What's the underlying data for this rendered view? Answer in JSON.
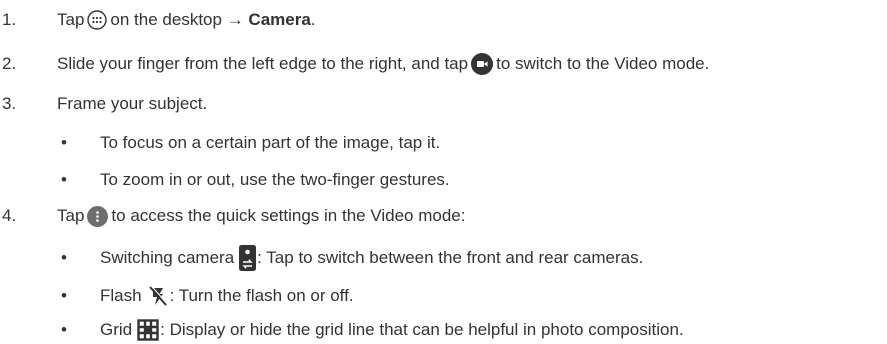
{
  "steps": [
    {
      "num": "1.",
      "pre": "Tap",
      "mid": "on the desktop",
      "arrow": "→",
      "bold": "Camera",
      "end": "."
    },
    {
      "num": "2.",
      "pre": "Slide your finger from the left edge to the right, and tap",
      "post": "to switch to the Video mode."
    },
    {
      "num": "3.",
      "text": "Frame your subject."
    },
    {
      "num": "4.",
      "pre": "Tap",
      "post": "to access the quick settings in the Video mode:"
    }
  ],
  "bullets3": [
    "To focus on a certain part of the image, tap it.",
    "To zoom in or out, use the two-finger gestures."
  ],
  "bullets4": [
    {
      "pre": "Switching camera",
      "post": ": Tap to switch between the front and rear cameras.",
      "icon": "switch-camera-icon"
    },
    {
      "pre": "Flash",
      "post": ": Turn the flash on or off.",
      "icon": "flash-off-icon"
    },
    {
      "pre": "Grid",
      "post": ": Display or hide the grid line that can be helpful in photo composition.",
      "icon": "grid-icon"
    }
  ],
  "bullet_char": "•",
  "icons": [
    "apps-icon",
    "video-mode-icon",
    "more-icon",
    "switch-camera-icon",
    "flash-off-icon",
    "grid-icon"
  ],
  "colors": {
    "text": "#333333",
    "icon_dark": "#333333",
    "icon_grey": "#6d6d6d"
  }
}
